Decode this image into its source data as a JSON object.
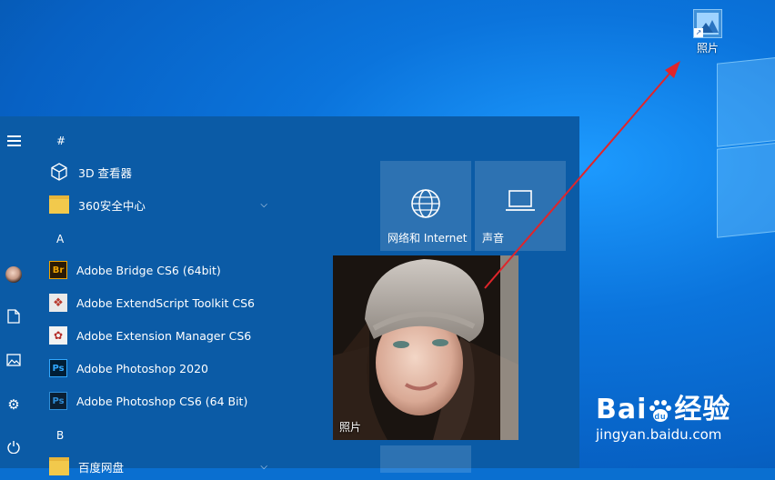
{
  "desktop": {
    "icon_label": "照片"
  },
  "start_menu": {
    "groups": {
      "hash": "#",
      "a": "A",
      "b": "B"
    },
    "apps": [
      {
        "label": "3D 查看器",
        "icon": "cube-icon"
      },
      {
        "label": "360安全中心",
        "icon": "folder-icon",
        "expandable": true
      },
      {
        "label": "Adobe Bridge CS6 (64bit)",
        "icon": "adobe-bridge-icon",
        "icon_text": "Br"
      },
      {
        "label": "Adobe ExtendScript Toolkit CS6",
        "icon": "extendscript-icon",
        "icon_text": "❖"
      },
      {
        "label": "Adobe Extension Manager CS6",
        "icon": "extension-manager-icon",
        "icon_text": "✿"
      },
      {
        "label": "Adobe Photoshop 2020",
        "icon": "photoshop-icon",
        "icon_text": "Ps"
      },
      {
        "label": "Adobe Photoshop CS6 (64 Bit)",
        "icon": "photoshop-cs6-icon",
        "icon_text": "Ps"
      },
      {
        "label": "百度网盘",
        "icon": "folder-icon",
        "expandable": true
      }
    ],
    "tiles": {
      "network_label": "网络和 Internet",
      "sound_label": "声音",
      "photos_label": "照片"
    }
  },
  "watermark": {
    "brand": "Bai",
    "brand_cn": "经验",
    "url": "jingyan.baidu.com"
  },
  "colors": {
    "start_bg": "#0b5ba6",
    "annotation_arrow": "#e0252a"
  }
}
